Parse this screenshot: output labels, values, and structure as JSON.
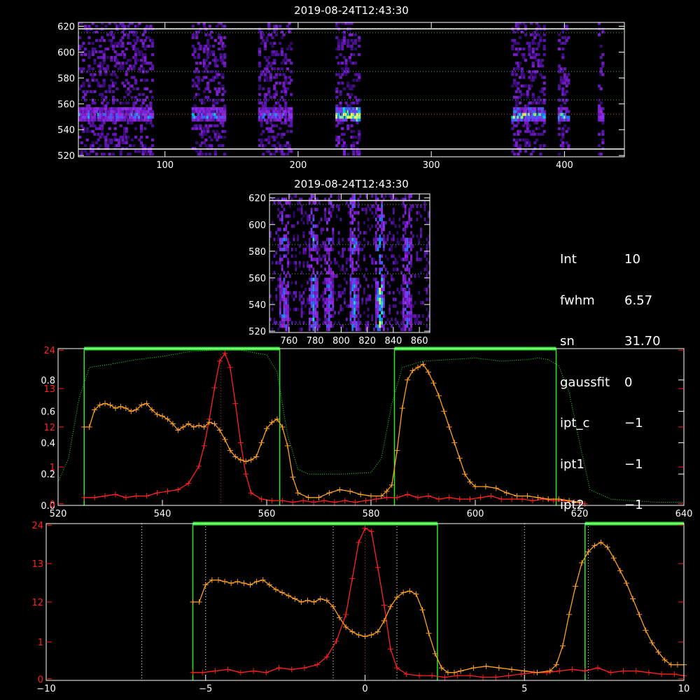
{
  "colors": {
    "background": "#000000",
    "axes": "#ffffff",
    "spectrum": "#ff2020",
    "profile": "#ffa020",
    "filter": "#22ee22",
    "dots": "#ffffff"
  },
  "stats": [
    {
      "key": "Int",
      "value": "10"
    },
    {
      "key": "fwhm",
      "value": "6.57"
    },
    {
      "key": "sn",
      "value": "31.70"
    },
    {
      "key": "gaussfit",
      "value": "0"
    },
    {
      "key": "ipt_c",
      "value": "−1"
    },
    {
      "key": "ipt1",
      "value": "−1"
    },
    {
      "key": "ipt2",
      "value": "−1"
    }
  ],
  "chart_data": [
    {
      "id": "map-top",
      "type": "heatmap",
      "title": "2019-08-24T12:43:30",
      "xlim": [
        35,
        445
      ],
      "ylim": [
        519,
        623
      ],
      "xticks": [
        "100",
        "200",
        "300",
        "400"
      ],
      "yticks": [
        "520",
        "540",
        "560",
        "580",
        "600",
        "620"
      ],
      "xtick_values": [
        100,
        200,
        300,
        400
      ],
      "ytick_values": [
        520,
        540,
        560,
        580,
        600,
        620
      ],
      "hlines_dotted": [
        552,
        563,
        585,
        615
      ],
      "hlines_solid": [
        525,
        618
      ],
      "bright_rows": [
        545,
        556
      ],
      "blocks": [
        {
          "x": [
            35,
            90
          ],
          "intensity": 0.55
        },
        {
          "x": [
            120,
            145
          ],
          "intensity": 0.55
        },
        {
          "x": [
            170,
            195
          ],
          "intensity": 0.5
        },
        {
          "x": [
            228,
            245
          ],
          "intensity": 0.95
        },
        {
          "x": [
            360,
            385
          ],
          "intensity": 0.75
        },
        {
          "x": [
            395,
            403
          ],
          "intensity": 0.7
        },
        {
          "x": [
            425,
            428
          ],
          "intensity": 0.5
        }
      ]
    },
    {
      "id": "map-zoom",
      "type": "heatmap",
      "title": "2019-08-24T12:43:30",
      "xlim": [
        745,
        868
      ],
      "ylim": [
        519,
        623
      ],
      "xticks": [
        "760",
        "780",
        "800",
        "820",
        "840",
        "860"
      ],
      "yticks": [
        "520",
        "540",
        "560",
        "580",
        "600",
        "620"
      ],
      "xtick_values": [
        760,
        780,
        800,
        820,
        840,
        860
      ],
      "ytick_values": [
        520,
        540,
        560,
        580,
        600,
        620
      ],
      "hlines_dotted": [
        525,
        563,
        585,
        615
      ],
      "hlines_solid": [
        618
      ],
      "columns": [
        {
          "x": 755,
          "intensity": 0.45
        },
        {
          "x": 778,
          "intensity": 0.55
        },
        {
          "x": 790,
          "intensity": 0.35
        },
        {
          "x": 809,
          "intensity": 0.7
        },
        {
          "x": 829,
          "intensity": 0.95
        },
        {
          "x": 850,
          "intensity": 0.35
        }
      ]
    },
    {
      "id": "spectrum",
      "type": "line",
      "xlim": [
        520,
        640
      ],
      "ylim": [
        0,
        1
      ],
      "xticks": [
        "520",
        "540",
        "560",
        "580",
        "600",
        "620",
        "640"
      ],
      "xtick_values": [
        520,
        540,
        560,
        580,
        600,
        620,
        640
      ],
      "yticks_white": [
        "0.0",
        "0.2",
        "0.4",
        "0.6",
        "0.8"
      ],
      "ytick_white_values": [
        0,
        0.2,
        0.4,
        0.6,
        0.8
      ],
      "yticks_red": [
        "0",
        "1",
        "12",
        "13",
        "24"
      ],
      "ytick_red_values": [
        0.01,
        0.245,
        0.5,
        0.745,
        0.99
      ],
      "filters": [
        [
          525,
          562.5
        ],
        [
          584.5,
          615.5
        ]
      ],
      "center_line": 551.2,
      "series": [
        {
          "color": "red",
          "x": [
            525,
            527,
            529,
            531,
            533,
            535,
            537,
            539,
            541,
            543,
            545,
            547,
            548,
            549,
            550,
            551,
            552,
            553,
            554,
            555,
            556,
            557,
            559,
            561,
            563,
            565,
            567,
            569,
            571,
            573,
            575,
            577,
            579,
            581,
            583,
            585,
            587,
            589,
            591,
            593,
            595,
            597,
            599,
            601,
            603,
            605,
            607,
            609,
            611,
            613,
            615,
            617,
            619,
            621
          ],
          "y": [
            0.05,
            0.05,
            0.06,
            0.07,
            0.05,
            0.06,
            0.06,
            0.08,
            0.09,
            0.1,
            0.14,
            0.25,
            0.38,
            0.55,
            0.75,
            0.92,
            0.97,
            0.88,
            0.65,
            0.4,
            0.2,
            0.08,
            0.04,
            0.03,
            0.03,
            0.02,
            0.03,
            0.02,
            0.03,
            0.02,
            0.03,
            0.02,
            0.03,
            0.04,
            0.05,
            0.05,
            0.07,
            0.05,
            0.06,
            0.04,
            0.05,
            0.04,
            0.04,
            0.05,
            0.06,
            0.04,
            0.04,
            0.04,
            0.03,
            0.04,
            0.03,
            0.03,
            0.02,
            0.01
          ]
        },
        {
          "color": "orange",
          "x": [
            525,
            526,
            527,
            528,
            529,
            530,
            531,
            532,
            533,
            534,
            535,
            536,
            537,
            538,
            539,
            540,
            541,
            542,
            543,
            544,
            545,
            546,
            547,
            548,
            549,
            550,
            551,
            552,
            553,
            554,
            555,
            556,
            557,
            558,
            559,
            560,
            561,
            562,
            563,
            564,
            565,
            566,
            568,
            570,
            572,
            574,
            576,
            578,
            580,
            582,
            583,
            584,
            585,
            586,
            587,
            588,
            589,
            590,
            591,
            592,
            593,
            594,
            595,
            596,
            597,
            598,
            599,
            600,
            602,
            604,
            606,
            608,
            610,
            612,
            614,
            616,
            618,
            620
          ],
          "y": [
            0.5,
            0.5,
            0.61,
            0.64,
            0.65,
            0.64,
            0.62,
            0.63,
            0.62,
            0.6,
            0.61,
            0.64,
            0.65,
            0.61,
            0.58,
            0.57,
            0.55,
            0.52,
            0.48,
            0.5,
            0.52,
            0.5,
            0.51,
            0.5,
            0.53,
            0.52,
            0.48,
            0.42,
            0.35,
            0.31,
            0.29,
            0.28,
            0.29,
            0.31,
            0.4,
            0.49,
            0.53,
            0.55,
            0.5,
            0.38,
            0.18,
            0.08,
            0.05,
            0.05,
            0.08,
            0.1,
            0.09,
            0.07,
            0.06,
            0.06,
            0.09,
            0.13,
            0.35,
            0.62,
            0.8,
            0.86,
            0.88,
            0.9,
            0.85,
            0.78,
            0.7,
            0.6,
            0.5,
            0.4,
            0.3,
            0.2,
            0.15,
            0.12,
            0.12,
            0.11,
            0.08,
            0.06,
            0.06,
            0.05,
            0.04,
            0.04,
            0.03,
            0.02
          ]
        }
      ],
      "filter_curve": {
        "color": "green",
        "x": [
          520,
          522,
          524,
          526,
          528,
          530,
          535,
          540,
          545,
          550,
          555,
          560,
          562,
          564,
          566,
          568,
          570,
          575,
          580,
          582,
          584,
          586,
          590,
          595,
          600,
          605,
          610,
          612,
          614,
          616,
          618,
          620,
          622,
          626,
          630,
          635,
          640
        ],
        "y": [
          0.15,
          0.3,
          0.68,
          0.88,
          0.89,
          0.9,
          0.93,
          0.95,
          0.98,
          0.99,
          0.99,
          0.96,
          0.85,
          0.45,
          0.23,
          0.2,
          0.2,
          0.2,
          0.21,
          0.3,
          0.65,
          0.88,
          0.92,
          0.93,
          0.94,
          0.92,
          0.93,
          0.94,
          0.93,
          0.89,
          0.72,
          0.4,
          0.1,
          0.04,
          0.03,
          0.02,
          0.02
        ]
      }
    },
    {
      "id": "velocity",
      "type": "line",
      "xlim": [
        -10,
        10
      ],
      "ylim": [
        0,
        1
      ],
      "xticks": [
        "−10",
        "−5",
        "0",
        "5",
        "10"
      ],
      "xtick_values": [
        -10,
        -5,
        0,
        5,
        10
      ],
      "yticks_red": [
        "0",
        "1",
        "12",
        "13",
        "24"
      ],
      "ytick_red_values": [
        0.01,
        0.245,
        0.5,
        0.745,
        0.99
      ],
      "filters": [
        [
          -5.4,
          2.27
        ],
        [
          6.9,
          10
        ]
      ],
      "vlines_dotted": [
        -7,
        -5,
        -1,
        1,
        5,
        7
      ],
      "center_line": 0,
      "series": [
        {
          "color": "red",
          "x": [
            -5.4,
            -5.1,
            -4.7,
            -4.3,
            -3.9,
            -3.5,
            -3.1,
            -2.7,
            -2.3,
            -1.9,
            -1.5,
            -1.2,
            -0.9,
            -0.6,
            -0.4,
            -0.2,
            0,
            0.2,
            0.4,
            0.6,
            0.8,
            1.0,
            1.3,
            1.7,
            2.1,
            2.5,
            2.9,
            3.3,
            3.7,
            4.1,
            4.5,
            4.9,
            5.3,
            5.7,
            6.1,
            6.5,
            6.9,
            7.3,
            7.7,
            8.1,
            8.5,
            8.9,
            9.3,
            9.7,
            10
          ],
          "y": [
            0.05,
            0.05,
            0.06,
            0.07,
            0.05,
            0.06,
            0.05,
            0.08,
            0.07,
            0.08,
            0.1,
            0.15,
            0.25,
            0.42,
            0.65,
            0.88,
            0.97,
            0.95,
            0.72,
            0.48,
            0.2,
            0.08,
            0.04,
            0.03,
            0.03,
            0.02,
            0.03,
            0.03,
            0.02,
            0.02,
            0.03,
            0.04,
            0.05,
            0.05,
            0.06,
            0.07,
            0.06,
            0.08,
            0.05,
            0.06,
            0.06,
            0.05,
            0.04,
            0.04,
            0.03
          ]
        },
        {
          "color": "orange",
          "x": [
            -5.4,
            -5.2,
            -5.0,
            -4.8,
            -4.6,
            -4.4,
            -4.2,
            -4.0,
            -3.8,
            -3.6,
            -3.4,
            -3.2,
            -3.0,
            -2.8,
            -2.6,
            -2.4,
            -2.2,
            -2.0,
            -1.8,
            -1.6,
            -1.4,
            -1.2,
            -1.0,
            -0.8,
            -0.6,
            -0.4,
            -0.2,
            0,
            0.2,
            0.4,
            0.6,
            0.8,
            1.0,
            1.2,
            1.4,
            1.6,
            1.8,
            2.0,
            2.2,
            2.4,
            2.6,
            2.8,
            3.0,
            3.4,
            3.8,
            4.2,
            4.6,
            5.0,
            5.4,
            5.8,
            6.0,
            6.2,
            6.4,
            6.6,
            6.8,
            7.0,
            7.2,
            7.4,
            7.6,
            7.8,
            8.0,
            8.2,
            8.4,
            8.6,
            8.8,
            9.0,
            9.2,
            9.4,
            9.6,
            9.8,
            10
          ],
          "y": [
            0.5,
            0.5,
            0.61,
            0.64,
            0.64,
            0.63,
            0.62,
            0.63,
            0.62,
            0.61,
            0.63,
            0.64,
            0.61,
            0.58,
            0.56,
            0.54,
            0.52,
            0.5,
            0.51,
            0.5,
            0.52,
            0.51,
            0.47,
            0.4,
            0.34,
            0.31,
            0.29,
            0.28,
            0.29,
            0.31,
            0.38,
            0.47,
            0.53,
            0.56,
            0.57,
            0.55,
            0.45,
            0.3,
            0.17,
            0.08,
            0.05,
            0.05,
            0.06,
            0.08,
            0.09,
            0.08,
            0.07,
            0.06,
            0.05,
            0.06,
            0.1,
            0.22,
            0.42,
            0.6,
            0.75,
            0.82,
            0.86,
            0.88,
            0.85,
            0.78,
            0.7,
            0.62,
            0.52,
            0.42,
            0.32,
            0.24,
            0.18,
            0.13,
            0.1,
            0.1,
            0.1
          ]
        }
      ]
    }
  ]
}
